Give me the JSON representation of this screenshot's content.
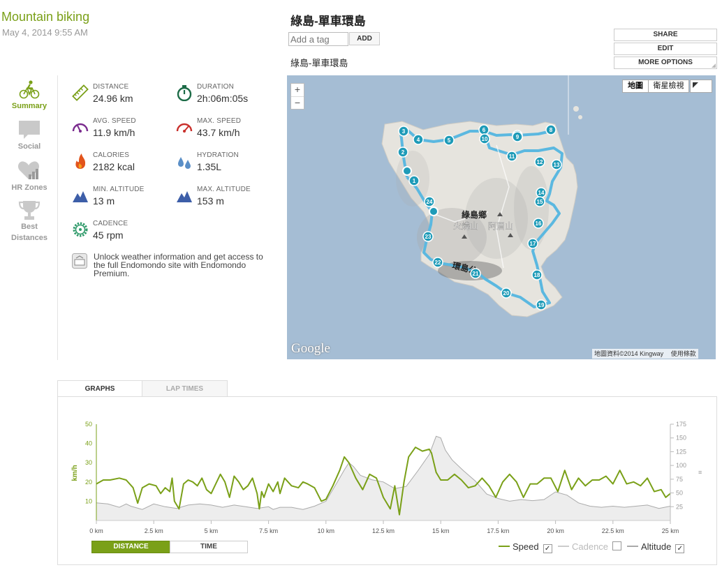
{
  "workout": {
    "sport": "Mountain biking",
    "datetime": "May 4, 2014 9:55 AM",
    "title": "綠島-單車環島",
    "route_name": "綠島-單車環島"
  },
  "tag": {
    "placeholder": "Add a tag",
    "add_label": "ADD"
  },
  "options": {
    "share": "SHARE",
    "edit": "EDIT",
    "more": "MORE OPTIONS"
  },
  "nav": [
    {
      "label": "Summary",
      "icon": "bike-rider-icon",
      "active": true
    },
    {
      "label": "Social",
      "icon": "speech-bubble-icon",
      "active": false
    },
    {
      "label": "HR Zones",
      "icon": "heart-chart-icon",
      "active": false
    },
    {
      "label": "Best Distances",
      "icon": "trophy-icon",
      "active": false
    }
  ],
  "stats": [
    {
      "label": "DISTANCE",
      "value": "24.96 km",
      "icon": "ruler-icon"
    },
    {
      "label": "DURATION",
      "value": "2h:06m:05s",
      "icon": "stopwatch-icon"
    },
    {
      "label": "AVG. SPEED",
      "value": "11.9 km/h",
      "icon": "speedometer-icon"
    },
    {
      "label": "MAX. SPEED",
      "value": "43.7 km/h",
      "icon": "speedometer-max-icon"
    },
    {
      "label": "CALORIES",
      "value": "2182 kcal",
      "icon": "flame-icon"
    },
    {
      "label": "HYDRATION",
      "value": "1.35L",
      "icon": "water-drops-icon"
    },
    {
      "label": "MIN. ALTITUDE",
      "value": "13 m",
      "icon": "mountain-icon"
    },
    {
      "label": "MAX. ALTITUDE",
      "value": "153 m",
      "icon": "mountain-icon"
    },
    {
      "label": "CADENCE",
      "value": "45 rpm",
      "icon": "gear-icon"
    }
  ],
  "premium": {
    "text": "Unlock weather information and get access to the full Endomondo site with Endomondo Premium.",
    "icon": "weather-icon"
  },
  "map": {
    "type_map": "地圖",
    "type_satellite": "衛星檢視",
    "zoom_in": "+",
    "zoom_out": "−",
    "labels": {
      "village": "綠島鄉",
      "peak1": "火燒山",
      "peak2": "阿眉山",
      "road": "環島公"
    },
    "markers": [
      "1",
      "2",
      "3",
      "4",
      "5",
      "6",
      "7",
      "8",
      "9",
      "10",
      "11",
      "12",
      "13",
      "14",
      "15",
      "16",
      "17",
      "18",
      "19",
      "20",
      "21",
      "22",
      "23",
      "24"
    ],
    "google": "Google",
    "attribution": "地圖資料©2014 Kingway",
    "terms": "使用條款"
  },
  "tabs": {
    "graphs": "GRAPHS",
    "lap_times": "LAP TIMES"
  },
  "axis_toggle": {
    "distance": "DISTANCE",
    "time": "TIME"
  },
  "legend": [
    {
      "name": "Speed",
      "checked": true,
      "color": "#7aa018"
    },
    {
      "name": "Cadence",
      "checked": false,
      "color": "#bbbbbb"
    },
    {
      "name": "Altitude",
      "checked": true,
      "color": "#999999"
    }
  ],
  "colors": {
    "accent": "#7aa018",
    "route": "#5bb8e0",
    "marker": "#1e9bb8"
  },
  "chart_data": {
    "type": "line",
    "xlabel": "",
    "ylabel": "km/h",
    "x_unit": "km",
    "xlim": [
      0,
      25
    ],
    "x_ticks": [
      "0 km",
      "2.5 km",
      "5 km",
      "7.5 km",
      "10 km",
      "12.5 km",
      "15 km",
      "17.5 km",
      "20 km",
      "22.5 km",
      "25 km"
    ],
    "y_left": {
      "label": "km/h",
      "ylim": [
        0,
        50
      ],
      "ticks": [
        10,
        20,
        30,
        40,
        50
      ]
    },
    "y_right": {
      "ylim": [
        0,
        175
      ],
      "ticks": [
        25,
        50,
        75,
        100,
        125,
        150,
        175
      ]
    },
    "series": [
      {
        "name": "Speed",
        "axis": "left",
        "x": [
          0,
          0.3,
          0.6,
          1.0,
          1.3,
          1.6,
          1.7,
          1.8,
          2.0,
          2.3,
          2.6,
          2.8,
          3.0,
          3.2,
          3.3,
          3.4,
          3.6,
          3.8,
          4.0,
          4.2,
          4.4,
          4.6,
          4.8,
          5.0,
          5.2,
          5.4,
          5.6,
          5.8,
          6.0,
          6.2,
          6.4,
          6.6,
          6.8,
          7.0,
          7.1,
          7.2,
          7.3,
          7.5,
          7.7,
          7.9,
          8.0,
          8.2,
          8.5,
          8.8,
          9.0,
          9.2,
          9.5,
          9.8,
          10.0,
          10.3,
          10.6,
          10.8,
          11.0,
          11.3,
          11.6,
          11.9,
          12.2,
          12.5,
          12.8,
          13.0,
          13.2,
          13.4,
          13.6,
          13.9,
          14.2,
          14.5,
          14.6,
          14.8,
          15.0,
          15.3,
          15.6,
          15.9,
          16.2,
          16.5,
          16.8,
          17.1,
          17.4,
          17.7,
          18.0,
          18.3,
          18.6,
          18.9,
          19.2,
          19.5,
          19.8,
          20.1,
          20.4,
          20.7,
          21.0,
          21.3,
          21.6,
          21.9,
          22.2,
          22.5,
          22.8,
          23.1,
          23.4,
          23.7,
          24.0,
          24.3,
          24.6,
          24.8,
          25.0
        ],
        "y": [
          19,
          21,
          21,
          22,
          21,
          17,
          13,
          9,
          17,
          19,
          18,
          14,
          17,
          15,
          22,
          10,
          6,
          19,
          21,
          20,
          18,
          22,
          16,
          14,
          19,
          24,
          20,
          12,
          23,
          20,
          16,
          18,
          22,
          14,
          6,
          15,
          12,
          19,
          15,
          20,
          14,
          22,
          18,
          17,
          20,
          19,
          17,
          10,
          11,
          18,
          26,
          33,
          30,
          22,
          16,
          24,
          22,
          12,
          6,
          18,
          3,
          20,
          33,
          38,
          36,
          37,
          35,
          25,
          21,
          21,
          24,
          21,
          17,
          18,
          22,
          18,
          12,
          20,
          24,
          20,
          12,
          19,
          19,
          22,
          22,
          15,
          26,
          16,
          22,
          18,
          21,
          21,
          23,
          19,
          26,
          19,
          20,
          18,
          22,
          15,
          16,
          12,
          14
        ]
      },
      {
        "name": "Altitude",
        "axis": "right",
        "x": [
          0,
          0.5,
          1.0,
          1.3,
          1.5,
          2.0,
          2.5,
          3.0,
          3.5,
          4.0,
          4.5,
          5.0,
          5.5,
          6.0,
          6.5,
          7.0,
          7.5,
          7.7,
          8.0,
          8.5,
          9.0,
          9.5,
          10.0,
          10.5,
          10.8,
          11.0,
          11.2,
          11.5,
          12.0,
          12.5,
          13.0,
          13.5,
          14.0,
          14.5,
          14.8,
          15.0,
          15.2,
          15.5,
          16.0,
          16.5,
          17.0,
          17.5,
          18.0,
          18.5,
          19.0,
          19.5,
          20.0,
          20.5,
          21.0,
          21.5,
          22.0,
          22.5,
          23.0,
          23.5,
          24.0,
          24.5,
          25.0
        ],
        "y": [
          32,
          30,
          24,
          30,
          26,
          20,
          30,
          25,
          22,
          28,
          30,
          28,
          24,
          28,
          25,
          22,
          25,
          20,
          24,
          24,
          20,
          26,
          35,
          70,
          92,
          105,
          98,
          82,
          74,
          70,
          58,
          62,
          90,
          120,
          153,
          150,
          128,
          110,
          90,
          72,
          48,
          40,
          35,
          38,
          36,
          38,
          52,
          46,
          32,
          26,
          24,
          26,
          24,
          26,
          28,
          22,
          26
        ]
      }
    ]
  }
}
